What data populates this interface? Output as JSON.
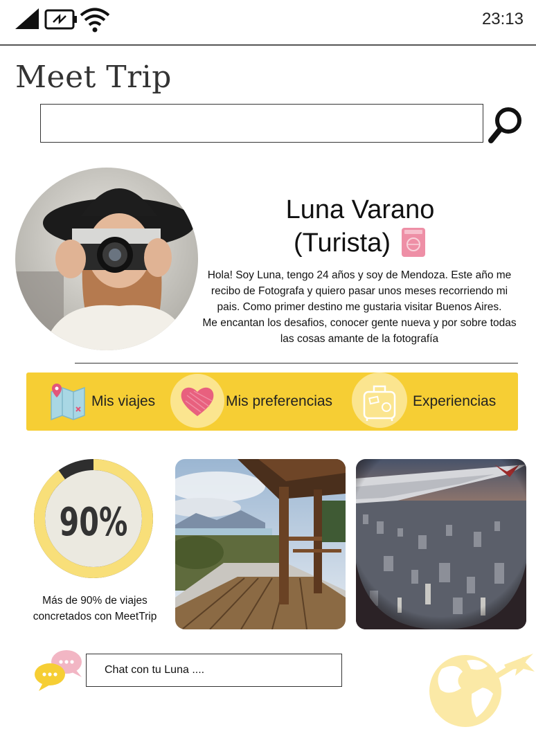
{
  "status_bar": {
    "time": "23:13"
  },
  "app": {
    "title": "Meet Trip"
  },
  "search": {
    "placeholder": ""
  },
  "profile": {
    "name": "Luna Varano",
    "role": "(Turista)",
    "bio": [
      "Hola! Soy Luna, tengo 24 años y soy de Mendoza. Este año me recibo de Fotografa y quiero pasar unos meses recorriendo mi pais. Como primer destino me gustaria visitar Buenos Aires.",
      "Me encantan los desafios, conocer gente nueva y por sobre todas las cosas amante de la fotografía"
    ]
  },
  "tabs": [
    {
      "label": "Mis viajes",
      "icon": "map-icon"
    },
    {
      "label": "Mis preferencias",
      "icon": "heart-icon"
    },
    {
      "label": "Experiencias",
      "icon": "suitcase-icon"
    }
  ],
  "stats": {
    "percent_label": "90%",
    "percent_value": 0.9,
    "description": "Más de 90% de viajes concretados con MeetTrip"
  },
  "chat": {
    "placeholder": "Chat con tu Luna ...."
  },
  "colors": {
    "accent_yellow": "#f6ce34",
    "light_yellow": "#fbe58f",
    "ring_track": "#2e2e2e",
    "ring_inner": "#ebe9e0",
    "chat_pink": "#f2b6c4"
  }
}
